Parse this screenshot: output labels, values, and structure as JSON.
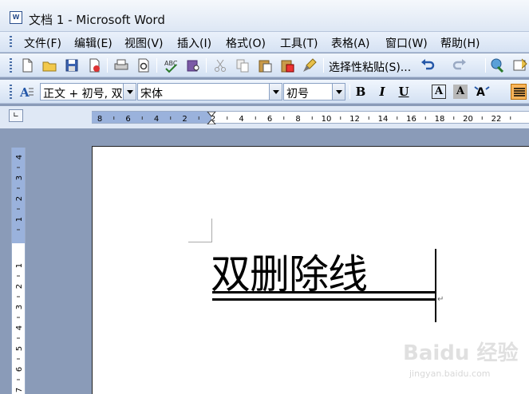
{
  "window": {
    "title": "文档 1 - Microsoft Word",
    "app_icon_text": "W"
  },
  "menu": [
    {
      "label": "文件(F)"
    },
    {
      "label": "编辑(E)"
    },
    {
      "label": "视图(V)"
    },
    {
      "label": "插入(I)"
    },
    {
      "label": "格式(O)"
    },
    {
      "label": "工具(T)"
    },
    {
      "label": "表格(A)"
    },
    {
      "label": "窗口(W)"
    },
    {
      "label": "帮助(H)"
    }
  ],
  "standard_toolbar": {
    "icons": [
      "new-doc-icon",
      "open-folder-icon",
      "save-icon",
      "permission-icon",
      "print-icon",
      "print-preview-icon",
      "spelling-icon",
      "research-icon",
      "cut-icon",
      "copy-icon",
      "paste-icon",
      "paste-format-icon",
      "format-painter-icon",
      "undo-icon",
      "redo-icon",
      "hyperlink-icon",
      "tables-borders-icon"
    ],
    "paste_special_label": "选择性粘贴(S)..."
  },
  "formatting_toolbar": {
    "style_value": "正文 + 初号, 双",
    "font_value": "宋体",
    "size_value": "初号",
    "bold_label": "B",
    "italic_label": "I",
    "underline_label": "U",
    "char_border_label": "A",
    "char_shading_label": "A"
  },
  "ruler": {
    "corner_glyph": "∟",
    "h_labels": [
      "8",
      "6",
      "4",
      "2",
      "2",
      "4",
      "6",
      "8",
      "10",
      "12",
      "14",
      "16",
      "18",
      "20",
      "22"
    ],
    "v_labels": [
      "4",
      "3",
      "2",
      "1",
      "1",
      "2",
      "3",
      "4",
      "5",
      "6",
      "7"
    ]
  },
  "document": {
    "text": "双删除线",
    "effect": "double-strikethrough",
    "paragraph_mark": "↵"
  },
  "watermark": {
    "main": "Baidu 经验",
    "sub": "jingyan.baidu.com"
  },
  "colors": {
    "title_bg": "#dde7f4",
    "toolbar_bg": "#d4e1f3",
    "workspace_bg": "#8a9bb8",
    "ruler_margin": "#9ab2dc"
  }
}
